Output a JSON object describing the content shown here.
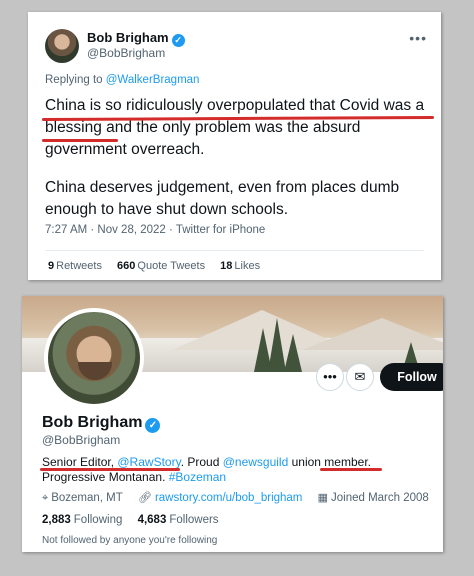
{
  "tweet": {
    "author_name": "Bob Brigham",
    "author_handle": "@BobBrigham",
    "replying_prefix": "Replying to",
    "replying_to": "@WalkerBragman",
    "para1": "China is so ridiculously overpopulated that Covid was a blessing and the only problem was the absurd government overreach.",
    "para2": "China deserves judgement, even from places dumb enough to have shut down schools.",
    "timestamp": "7:27 AM · Nov 28, 2022 · Twitter for iPhone",
    "stats": {
      "retweets_count": "9",
      "retweets_label": "Retweets",
      "quotes_count": "660",
      "quotes_label": "Quote Tweets",
      "likes_count": "18",
      "likes_label": "Likes"
    }
  },
  "profile": {
    "name": "Bob Brigham",
    "handle": "@BobBrigham",
    "bio": {
      "part1": "Senior Editor, ",
      "rawstory": "@RawStory",
      "part2": ". Proud ",
      "newsguild": "@newsguild",
      "part3": " union member. Progressive Montanan. ",
      "hashtag": "#Bozeman"
    },
    "location": "Bozeman, MT",
    "website": "rawstory.com/u/bob_brigham",
    "joined": "Joined March 2008",
    "following_count": "2,883",
    "following_label": "Following",
    "followers_count": "4,683",
    "followers_label": "Followers",
    "follow_button": "Follow",
    "not_followed_text": "Not followed by anyone you're following"
  },
  "icons": [
    "verified-badge-icon",
    "more-icon",
    "message-icon",
    "location-icon",
    "link-icon",
    "calendar-icon"
  ],
  "colors": {
    "accent": "#1d9bf0",
    "annotation_red": "#d42b2b",
    "text": "#0f1419",
    "muted": "#536471"
  }
}
